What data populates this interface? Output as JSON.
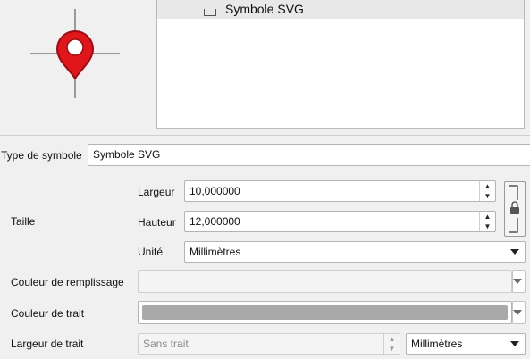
{
  "tree": {
    "selected_item": "Symbole SVG"
  },
  "symbol_type": {
    "label": "Type de symbole",
    "value": "Symbole SVG"
  },
  "size": {
    "label": "Taille",
    "width_label": "Largeur",
    "width_value": "10,000000",
    "height_label": "Hauteur",
    "height_value": "12,000000",
    "unit_label": "Unité",
    "unit_value": "Millimètres"
  },
  "fill_color": {
    "label": "Couleur de remplissage"
  },
  "stroke_color": {
    "label": "Couleur de trait",
    "swatch": "#a9a9a9"
  },
  "stroke_width": {
    "label": "Largeur de trait",
    "value": "Sans trait",
    "unit_value": "Millimètres"
  },
  "colors": {
    "marker_red": "#e0161b",
    "marker_dark": "#9b0d10"
  },
  "icons": {
    "preview": "map-marker-icon",
    "lock": "lock-icon"
  }
}
